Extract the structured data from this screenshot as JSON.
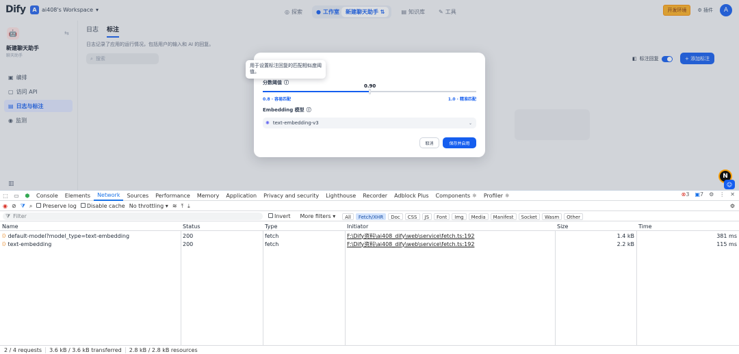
{
  "app": {
    "logo": "Dify",
    "workspace_badge": "A",
    "workspace_name": "ai408's Workspace",
    "nav": {
      "explore": "探索",
      "studio": "工作室",
      "current_app": "新建聊天助手",
      "knowledge": "知识库",
      "tools": "工具"
    },
    "dev_env": "开发环境",
    "plugins": "插件",
    "avatar": "A"
  },
  "sidebar": {
    "app_name": "新建聊天助手",
    "app_type": "聊天助手",
    "items": [
      {
        "label": "编排",
        "active": false
      },
      {
        "label": "访问 API",
        "active": false
      },
      {
        "label": "日志与标注",
        "active": true
      },
      {
        "label": "监测",
        "active": false
      }
    ]
  },
  "main": {
    "tabs": [
      {
        "label": "日志",
        "active": false
      },
      {
        "label": "标注",
        "active": true
      }
    ],
    "description": "日志记录了应用的运行情况，包括用户的输入和 AI 的回复。",
    "search_placeholder": "搜索",
    "annotation_reply_label": "标注回复",
    "add_annotation_label": "+ 添加标注"
  },
  "modal": {
    "tooltip": "用于设置标注回复的匹配相似度阈值。",
    "score_label": "分数阈值",
    "score_value": "0.90",
    "score_fraction": 0.5,
    "low_label": "0.8 · 容易匹配",
    "high_label": "1.0 · 精准匹配",
    "embedding_label": "Embedding 模型",
    "embedding_model": "text-embedding-v3",
    "cancel_label": "取消",
    "save_label": "保存并启用"
  },
  "floating": {
    "n_badge": "N"
  },
  "devtools": {
    "tabs": [
      "Console",
      "Elements",
      "Network",
      "Sources",
      "Performance",
      "Memory",
      "Application",
      "Privacy and security",
      "Lighthouse",
      "Recorder",
      "Adblock Plus",
      "Components ⚛",
      "Profiler ⚛"
    ],
    "active_tab": "Network",
    "error_count": "3",
    "warning_count": "7",
    "toolbar": {
      "preserve_log": "Preserve log",
      "disable_cache": "Disable cache",
      "throttling": "No throttling"
    },
    "filter": {
      "placeholder": "Filter",
      "invert": "Invert",
      "more_filters": "More filters",
      "chips": [
        "All",
        "Fetch/XHR",
        "Doc",
        "CSS",
        "JS",
        "Font",
        "Img",
        "Media",
        "Manifest",
        "Socket",
        "Wasm",
        "Other"
      ],
      "active_chip": "Fetch/XHR"
    },
    "columns": [
      "Name",
      "Status",
      "Type",
      "Initiator",
      "Size",
      "Time"
    ],
    "rows": [
      {
        "name": "default-model?model_type=text-embedding",
        "status": "200",
        "type": "fetch",
        "initiator": "F:\\Dify资料\\ai408_dify\\web\\service\\fetch.ts:192",
        "size": "1.4 kB",
        "time": "381 ms"
      },
      {
        "name": "text-embedding",
        "status": "200",
        "type": "fetch",
        "initiator": "F:\\Dify资料\\ai408_dify\\web\\service\\fetch.ts:192",
        "size": "2.2 kB",
        "time": "115 ms"
      }
    ],
    "status_bar": {
      "requests": "2 / 4 requests",
      "transferred": "3.6 kB / 3.6 kB transferred",
      "resources": "2.8 kB / 2.8 kB resources"
    }
  }
}
